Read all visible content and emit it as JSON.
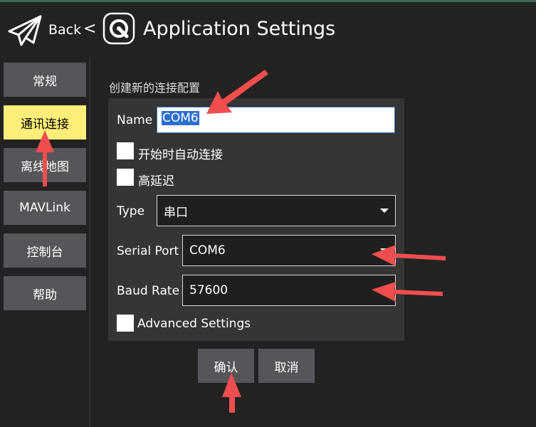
{
  "header": {
    "back_label": "Back",
    "back_separator": "<",
    "title": "Application Settings"
  },
  "sidebar": {
    "items": [
      {
        "label": "常规"
      },
      {
        "label": "通讯连接"
      },
      {
        "label": "离线地图"
      },
      {
        "label": "MAVLink"
      },
      {
        "label": "控制台"
      },
      {
        "label": "帮助"
      }
    ],
    "active_index": 1
  },
  "form": {
    "section_title": "创建新的连接配置",
    "name_label": "Name",
    "name_value": "COM6",
    "auto_connect_label": "开始时自动连接",
    "high_latency_label": "高延迟",
    "type_label": "Type",
    "type_value": "串口",
    "serial_port_label": "Serial Port",
    "serial_port_value": "COM6",
    "baud_rate_label": "Baud Rate",
    "baud_rate_value": "57600",
    "advanced_label": "Advanced Settings"
  },
  "actions": {
    "ok_label": "确认",
    "cancel_label": "取消"
  },
  "colors": {
    "background": "#222222",
    "button": "#56565a",
    "active_button": "#fcee78",
    "annotation_arrow": "#f04e4e",
    "selection": "#2d6fd1"
  }
}
